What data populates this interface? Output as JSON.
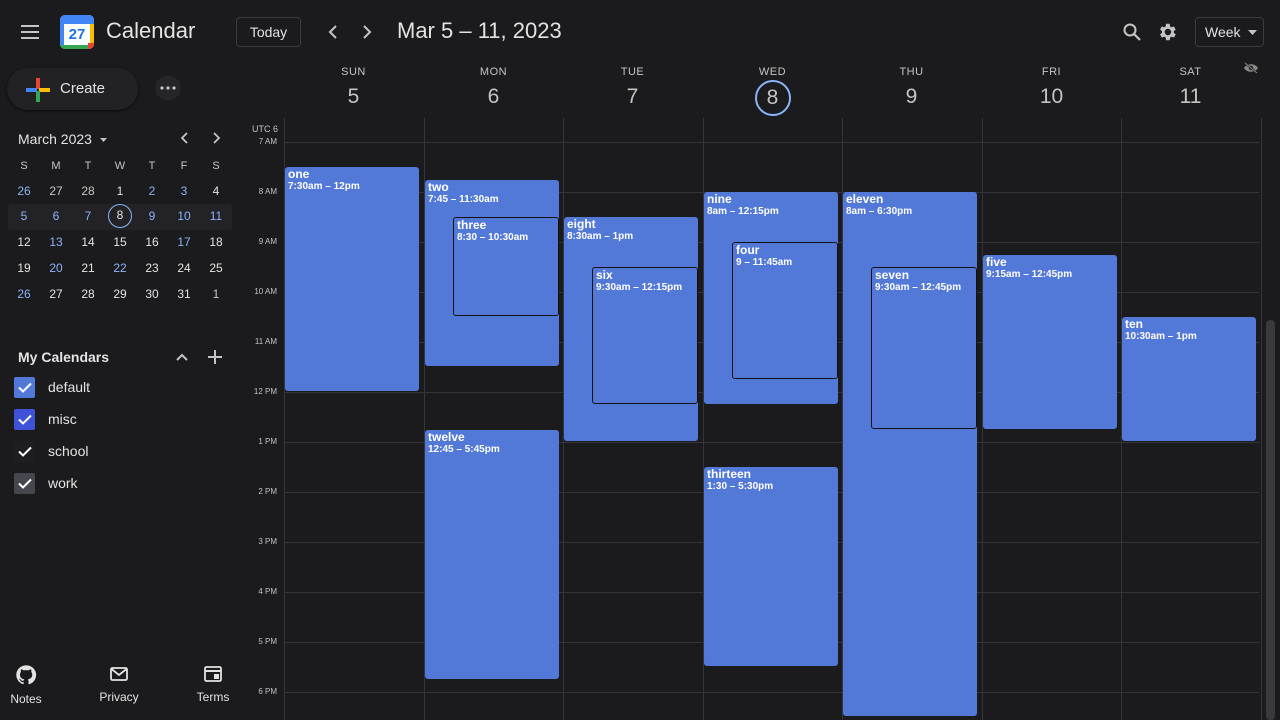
{
  "app": {
    "title": "Calendar",
    "logo_number": "27"
  },
  "header": {
    "today_label": "Today",
    "range_title": "Mar 5 – 11, 2023",
    "view_label": "Week"
  },
  "sidebar": {
    "create_label": "Create",
    "mini_calendar": {
      "title": "March 2023",
      "weekdays": [
        "S",
        "M",
        "T",
        "W",
        "T",
        "F",
        "S"
      ],
      "rows": [
        [
          "26",
          "27",
          "28",
          "1",
          "2",
          "3",
          "4"
        ],
        [
          "5",
          "6",
          "7",
          "8",
          "9",
          "10",
          "11"
        ],
        [
          "12",
          "13",
          "14",
          "15",
          "16",
          "17",
          "18"
        ],
        [
          "19",
          "20",
          "21",
          "22",
          "23",
          "24",
          "25"
        ],
        [
          "26",
          "27",
          "28",
          "29",
          "30",
          "31",
          "1"
        ]
      ]
    },
    "my_calendars": {
      "title": "My Calendars",
      "items": [
        {
          "label": "default",
          "color": "#5379d8"
        },
        {
          "label": "misc",
          "color": "#3f51d6"
        },
        {
          "label": "school",
          "color": "#1e1e22"
        },
        {
          "label": "work",
          "color": "#44474e"
        }
      ]
    },
    "footer": {
      "notes": "Notes",
      "privacy": "Privacy",
      "terms": "Terms"
    }
  },
  "week": {
    "timezone": "UTC 6",
    "days": [
      {
        "weekday": "SUN",
        "date": "5"
      },
      {
        "weekday": "MON",
        "date": "6"
      },
      {
        "weekday": "TUE",
        "date": "7"
      },
      {
        "weekday": "WED",
        "date": "8",
        "today": true
      },
      {
        "weekday": "THU",
        "date": "9"
      },
      {
        "weekday": "FRI",
        "date": "10"
      },
      {
        "weekday": "SAT",
        "date": "11"
      }
    ],
    "hours": [
      "7 AM",
      "8 AM",
      "9 AM",
      "10 AM",
      "11 AM",
      "12 PM",
      "1 PM",
      "2 PM",
      "3 PM",
      "4 PM",
      "5 PM",
      "6 PM"
    ],
    "event_color": "#5379d8",
    "events": [
      {
        "title": "one",
        "time": "7:30am – 12pm"
      },
      {
        "title": "two",
        "time": "7:45 – 11:30am"
      },
      {
        "title": "three",
        "time": "8:30 – 10:30am"
      },
      {
        "title": "twelve",
        "time": "12:45 – 5:45pm"
      },
      {
        "title": "eight",
        "time": "8:30am – 1pm"
      },
      {
        "title": "six",
        "time": "9:30am – 12:15pm"
      },
      {
        "title": "nine",
        "time": "8am – 12:15pm"
      },
      {
        "title": "four",
        "time": "9 – 11:45am"
      },
      {
        "title": "thirteen",
        "time": "1:30 – 5:30pm"
      },
      {
        "title": "eleven",
        "time": "8am – 6:30pm"
      },
      {
        "title": "seven",
        "time": "9:30am – 12:45pm"
      },
      {
        "title": "five",
        "time": "9:15am – 12:45pm"
      },
      {
        "title": "ten",
        "time": "10:30am – 1pm"
      }
    ]
  }
}
